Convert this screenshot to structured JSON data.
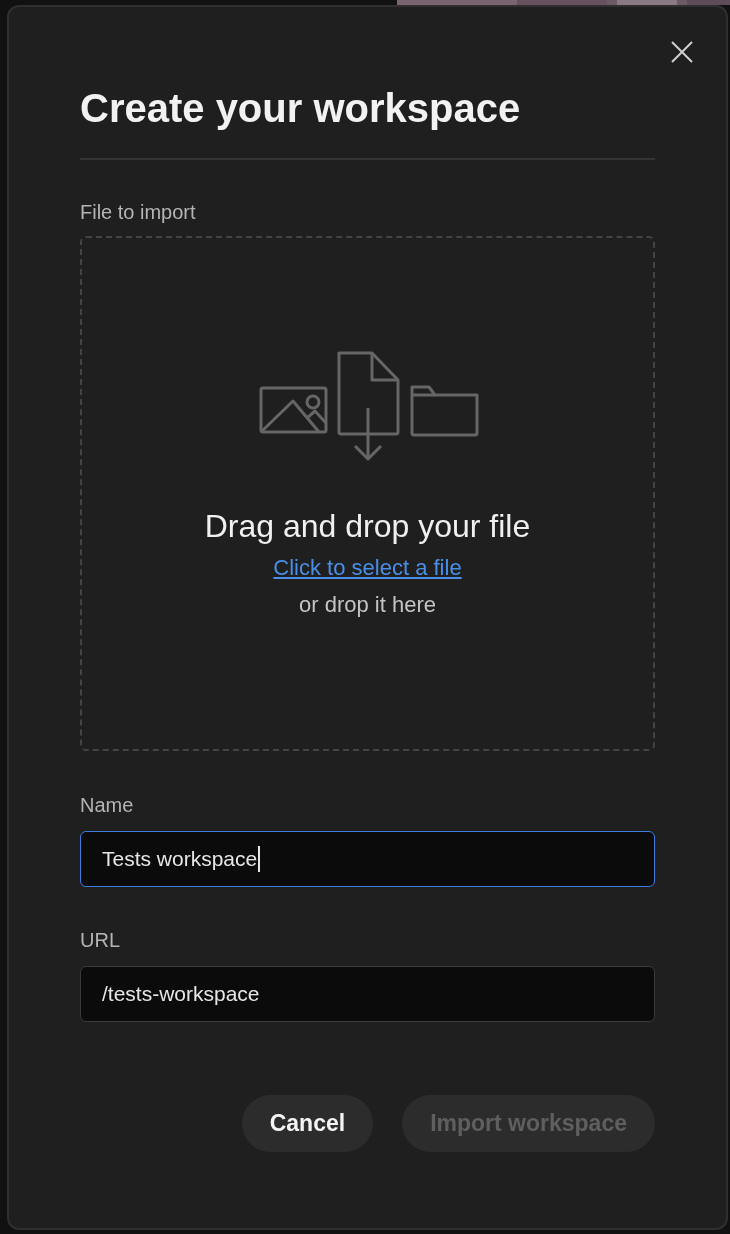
{
  "dialog": {
    "title": "Create your workspace",
    "file_import": {
      "label": "File to import",
      "heading": "Drag and drop your file",
      "link": "Click to select a file",
      "hint": "or drop it here"
    },
    "fields": [
      {
        "label": "Name",
        "value": "Tests workspace",
        "focused": true
      },
      {
        "label": "URL",
        "value": "/tests-workspace",
        "focused": false
      }
    ],
    "buttons": [
      {
        "label": "Cancel",
        "disabled": false
      },
      {
        "label": "Import workspace",
        "disabled": true
      }
    ]
  }
}
